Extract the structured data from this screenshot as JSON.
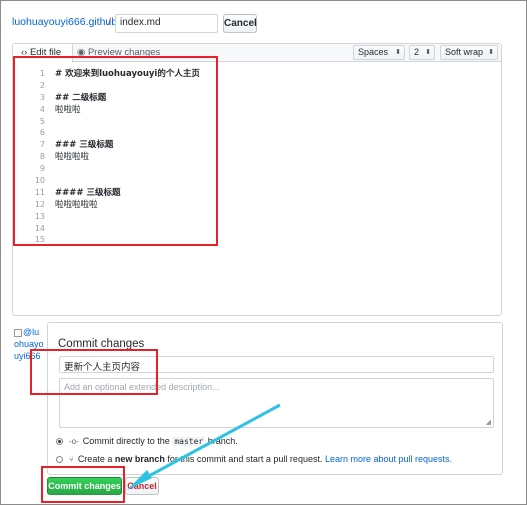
{
  "header": {
    "repo": "luohuayouyi666.github.io",
    "separator": "/",
    "filename_value": "index.md",
    "cancel_label": "Cancel"
  },
  "editor": {
    "tabs": {
      "edit": "Edit file",
      "preview": "Preview changes"
    },
    "indent_mode": "Spaces",
    "indent_size": "2",
    "wrap_mode": "Soft wrap",
    "lines": [
      {
        "n": "1",
        "text": "# 欢迎来到luohuayouyi的个人主页",
        "bold": true
      },
      {
        "n": "2",
        "text": "",
        "bold": false
      },
      {
        "n": "3",
        "text": "## 二级标题",
        "bold": true
      },
      {
        "n": "4",
        "text": "啦啦啦",
        "bold": false
      },
      {
        "n": "5",
        "text": "",
        "bold": false
      },
      {
        "n": "6",
        "text": "",
        "bold": false
      },
      {
        "n": "7",
        "text": "### 三级标题",
        "bold": true
      },
      {
        "n": "8",
        "text": "啦啦啦啦",
        "bold": false
      },
      {
        "n": "9",
        "text": "",
        "bold": false
      },
      {
        "n": "10",
        "text": "",
        "bold": false
      },
      {
        "n": "11",
        "text": "#### 三级标题",
        "bold": true
      },
      {
        "n": "12",
        "text": "啦啦啦啦啦",
        "bold": false
      },
      {
        "n": "13",
        "text": "",
        "bold": false
      },
      {
        "n": "14",
        "text": "",
        "bold": false
      },
      {
        "n": "15",
        "text": "",
        "bold": false
      }
    ]
  },
  "avatar": {
    "alt": "@luohuayouyi666"
  },
  "commit": {
    "title": "Commit changes",
    "summary_value": "更新个人主页内容",
    "description_placeholder": "Add an optional extended description...",
    "option_direct": {
      "prefix": "Commit directly to the",
      "branch": "master",
      "suffix": "branch."
    },
    "option_new_branch": {
      "prefix": "Create a",
      "bold": "new branch",
      "middle": "for this commit and start a pull request.",
      "link": "Learn more about pull requests."
    },
    "commit_button": "Commit changes",
    "cancel_button": "Cancel"
  },
  "colors": {
    "highlight": "#e8202a",
    "arrow": "#2ec3e0",
    "commit_green": "#28a745",
    "link_blue": "#0366d6"
  }
}
